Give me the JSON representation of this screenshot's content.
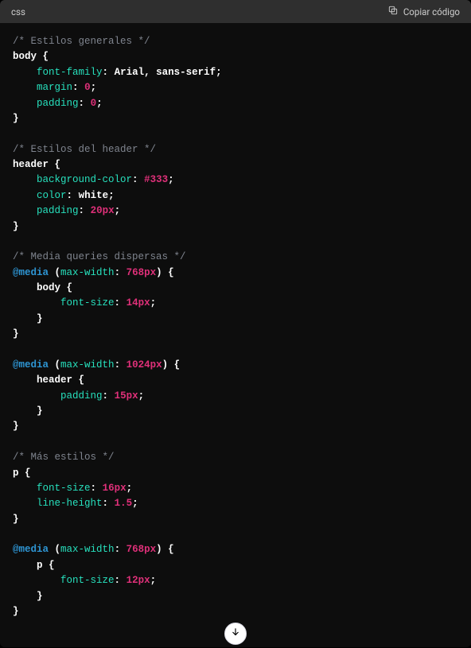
{
  "header": {
    "language": "css",
    "copy_label": "Copiar código"
  },
  "code": {
    "c1": "/* Estilos generales */",
    "sel_body": "body",
    "p_fontfamily": "font-family",
    "v_fontfamily": "Arial, sans-serif",
    "p_margin": "margin",
    "v_zero1": "0",
    "p_padding": "padding",
    "v_zero2": "0",
    "c2": "/* Estilos del header */",
    "sel_header": "header",
    "p_bgc": "background-color",
    "v_bgc": "#333",
    "p_color": "color",
    "v_white": "white",
    "p_padding2": "padding",
    "v_20px": "20px",
    "c3": "/* Media queries dispersas */",
    "at_media1": "@media",
    "mq_maxwidth": "max-width",
    "mq_768": "768px",
    "sel_body2": "body",
    "p_fontsize": "font-size",
    "v_14px": "14px",
    "at_media2": "@media",
    "mq_1024": "1024px",
    "sel_header2": "header",
    "p_padding3": "padding",
    "v_15px": "15px",
    "c4": "/* Más estilos */",
    "sel_p": "p",
    "p_fontsize2": "font-size",
    "v_16px": "16px",
    "p_lineheight": "line-height",
    "v_15": "1.5",
    "at_media3": "@media",
    "mq_768b": "768px",
    "sel_p2": "p",
    "p_fontsize3": "font-size",
    "v_12px": "12px"
  }
}
